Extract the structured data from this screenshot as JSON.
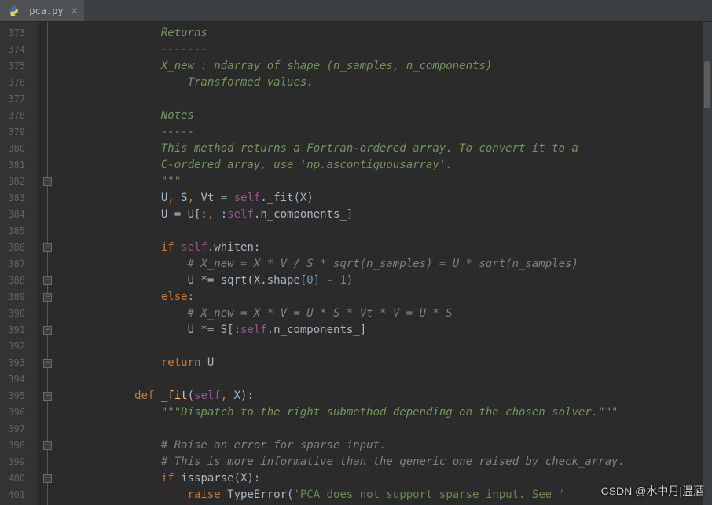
{
  "tab": {
    "filename": "_pca.py",
    "icon": "python-icon"
  },
  "line_start": 373,
  "line_end": 401,
  "watermark": "CSDN @水中月|温酒",
  "code": [
    {
      "n": 373,
      "indent": 16,
      "tokens": [
        [
          "docstring",
          "Returns"
        ]
      ]
    },
    {
      "n": 374,
      "indent": 16,
      "tokens": [
        [
          "docstring",
          "-------"
        ]
      ]
    },
    {
      "n": 375,
      "indent": 16,
      "tokens": [
        [
          "docstring",
          "X_new : ndarray of shape (n_samples, n_components)"
        ]
      ]
    },
    {
      "n": 376,
      "indent": 20,
      "tokens": [
        [
          "docstring",
          "Transformed values."
        ]
      ]
    },
    {
      "n": 377,
      "indent": 0,
      "tokens": []
    },
    {
      "n": 378,
      "indent": 16,
      "tokens": [
        [
          "docstring",
          "Notes"
        ]
      ]
    },
    {
      "n": 379,
      "indent": 16,
      "tokens": [
        [
          "docstring",
          "-----"
        ]
      ]
    },
    {
      "n": 380,
      "indent": 16,
      "tokens": [
        [
          "docstring",
          "This method returns a Fortran-ordered array. To convert it to a"
        ]
      ]
    },
    {
      "n": 381,
      "indent": 16,
      "tokens": [
        [
          "docstring",
          "C-ordered array, use 'np.ascontiguousarray'."
        ]
      ]
    },
    {
      "n": 382,
      "indent": 16,
      "tokens": [
        [
          "docstring",
          "\"\"\""
        ]
      ],
      "fold": "close"
    },
    {
      "n": 383,
      "indent": 16,
      "tokens": [
        [
          "id",
          "U"
        ],
        [
          "keyword",
          ", "
        ],
        [
          "id",
          "S"
        ],
        [
          "keyword",
          ", "
        ],
        [
          "id",
          "Vt = "
        ],
        [
          "self",
          "self"
        ],
        [
          "id",
          "._fit(X)"
        ]
      ]
    },
    {
      "n": 384,
      "indent": 16,
      "tokens": [
        [
          "id",
          "U = U[:"
        ],
        [
          "keyword",
          ", "
        ],
        [
          "id",
          ":"
        ],
        [
          "self",
          "self"
        ],
        [
          "id",
          ".n_components_]"
        ]
      ]
    },
    {
      "n": 385,
      "indent": 0,
      "tokens": []
    },
    {
      "n": 386,
      "indent": 16,
      "tokens": [
        [
          "keyword",
          "if "
        ],
        [
          "self",
          "self"
        ],
        [
          "id",
          ".whiten:"
        ]
      ],
      "fold": "open"
    },
    {
      "n": 387,
      "indent": 20,
      "tokens": [
        [
          "comment",
          "# X_new = X * V / S * sqrt(n_samples) = U * sqrt(n_samples)"
        ]
      ]
    },
    {
      "n": 388,
      "indent": 20,
      "tokens": [
        [
          "id",
          "U *= sqrt(X.shape["
        ],
        [
          "num",
          "0"
        ],
        [
          "id",
          "] - "
        ],
        [
          "num",
          "1"
        ],
        [
          "id",
          ")"
        ]
      ],
      "fold": "close"
    },
    {
      "n": 389,
      "indent": 16,
      "tokens": [
        [
          "keyword",
          "else"
        ],
        [
          "id",
          ":"
        ]
      ],
      "fold": "open"
    },
    {
      "n": 390,
      "indent": 20,
      "tokens": [
        [
          "comment",
          "# X_new = X * V = U * S * Vt * V = U * S"
        ]
      ]
    },
    {
      "n": 391,
      "indent": 20,
      "tokens": [
        [
          "id",
          "U *= S[:"
        ],
        [
          "self",
          "self"
        ],
        [
          "id",
          ".n_components_]"
        ]
      ],
      "fold": "close"
    },
    {
      "n": 392,
      "indent": 0,
      "tokens": []
    },
    {
      "n": 393,
      "indent": 16,
      "tokens": [
        [
          "keyword",
          "return "
        ],
        [
          "id",
          "U"
        ]
      ],
      "fold": "close"
    },
    {
      "n": 394,
      "indent": 0,
      "tokens": []
    },
    {
      "n": 395,
      "indent": 12,
      "tokens": [
        [
          "keyword",
          "def "
        ],
        [
          "funcname",
          "_fit"
        ],
        [
          "id",
          "("
        ],
        [
          "self",
          "self"
        ],
        [
          "keyword",
          ", "
        ],
        [
          "id",
          "X):"
        ]
      ],
      "fold": "open"
    },
    {
      "n": 396,
      "indent": 16,
      "tokens": [
        [
          "docstring",
          "\"\"\"Dispatch to the right submethod depending on the chosen solver.\"\"\""
        ]
      ]
    },
    {
      "n": 397,
      "indent": 0,
      "tokens": []
    },
    {
      "n": 398,
      "indent": 16,
      "tokens": [
        [
          "comment",
          "# Raise an error for sparse input."
        ]
      ],
      "fold": "open"
    },
    {
      "n": 399,
      "indent": 16,
      "tokens": [
        [
          "comment",
          "# This is more informative than the generic one raised by check_array."
        ]
      ]
    },
    {
      "n": 400,
      "indent": 16,
      "tokens": [
        [
          "keyword",
          "if "
        ],
        [
          "id",
          "issparse(X):"
        ]
      ],
      "fold": "open"
    },
    {
      "n": 401,
      "indent": 20,
      "tokens": [
        [
          "keyword",
          "raise "
        ],
        [
          "id",
          "TypeError("
        ],
        [
          "string",
          "'PCA does not support sparse input. See '"
        ]
      ]
    }
  ]
}
